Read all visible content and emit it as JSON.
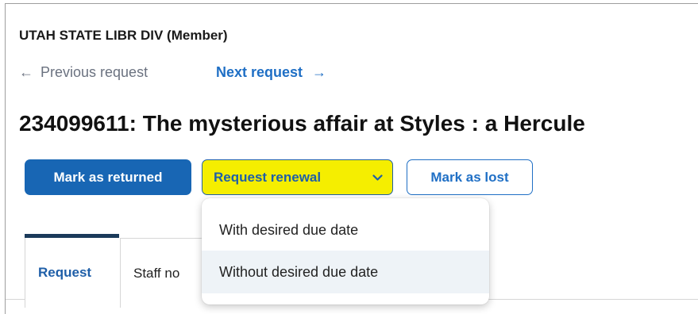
{
  "header": {
    "owner": "UTAH STATE LIBR DIV (Member)"
  },
  "navigation": {
    "previous_label": "Previous request",
    "previous_arrow": "←",
    "next_label": "Next request",
    "next_arrow": "→"
  },
  "request": {
    "title": "234099611: The mysterious affair at Styles : a Hercule"
  },
  "actions": {
    "mark_returned": "Mark as returned",
    "request_renewal": "Request renewal",
    "renewal_chevron": "⌄",
    "mark_lost": "Mark as lost"
  },
  "renewal_menu": {
    "items": [
      {
        "label": "With desired due date"
      },
      {
        "label": "Without desired due date",
        "highlighted": true
      }
    ]
  },
  "tabs": [
    {
      "label": "Request",
      "active": true
    },
    {
      "label": "Staff no",
      "active": false
    }
  ],
  "colors": {
    "primary_blue": "#1866b4",
    "link_blue": "#1f6fc5",
    "highlight_yellow": "#f5ee00",
    "tab_active_bar": "#1b3a5a",
    "menu_hover": "#eef3f7"
  },
  "icons": {
    "previous": "arrow-left-icon",
    "next": "arrow-right-icon",
    "renewal": "chevron-down-icon"
  }
}
